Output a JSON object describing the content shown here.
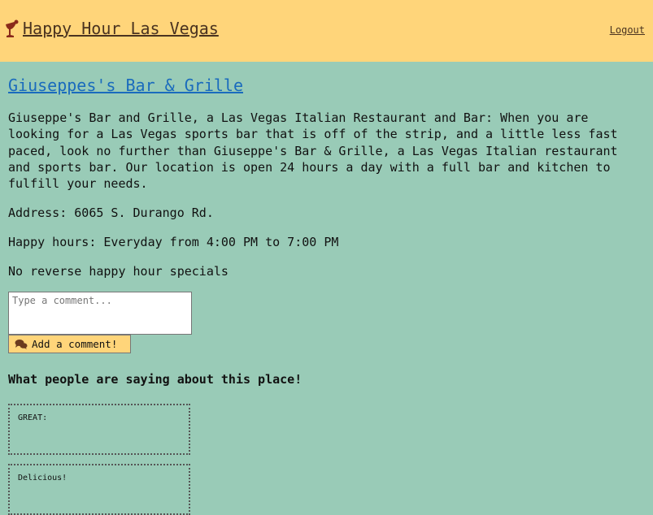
{
  "header": {
    "site_title": "Happy Hour Las Vegas",
    "logout_label": "Logout",
    "logo_icon": "cocktail-glass-icon"
  },
  "place": {
    "name": "Giuseppes's Bar & Grille",
    "description": "Giuseppe's Bar and Grille, a Las Vegas Italian Restaurant and Bar: When you are looking for a Las Vegas sports bar that is off of the strip, and a little less fast paced, look no further than Giuseppe's Bar & Grille, a Las Vegas Italian restaurant and sports bar. Our location is open 24 hours a day with a full bar and kitchen to fulfill your needs.",
    "address": "Address: 6065 S. Durango Rd.",
    "happy_hours": "Happy hours: Everyday from 4:00 PM to 7:00 PM",
    "reverse_happy_hour": "No reverse happy hour specials"
  },
  "comment_form": {
    "placeholder": "Type a comment...",
    "button_label": "Add a comment!",
    "button_icon": "comments-icon"
  },
  "reviews": {
    "heading": "What people are saying about this place!",
    "items": [
      {
        "text": "GREAT:"
      },
      {
        "text": "Delicious!"
      }
    ]
  },
  "colors": {
    "header_bg": "#ffd57a",
    "page_bg": "#99cbb7",
    "link_blue": "#1a6bbd",
    "brown_text": "#4a3320"
  }
}
